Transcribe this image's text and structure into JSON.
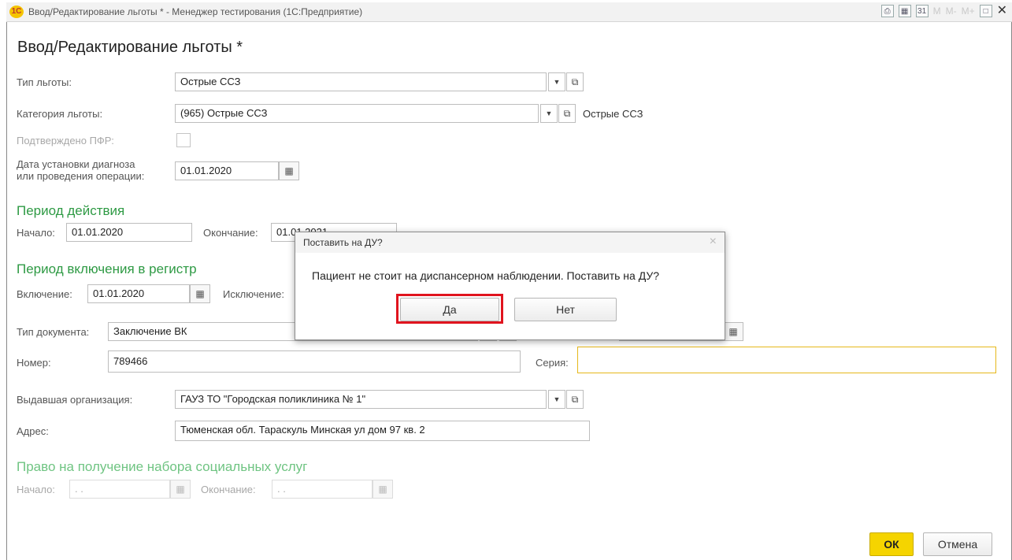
{
  "window": {
    "title": "Ввод/Редактирование льготы * - Менеджер тестирования (1С:Предприятие)",
    "logo_text": "1С"
  },
  "form": {
    "title": "Ввод/Редактирование льготы *",
    "benefit_type": {
      "label": "Тип льготы:",
      "value": "Острые ССЗ"
    },
    "benefit_category": {
      "label": "Категория льготы:",
      "value": "(965) Острые ССЗ",
      "note": "Острые ССЗ"
    },
    "pfr_confirmed": {
      "label": "Подтверждено ПФР:",
      "checked": false
    },
    "diagnosis_date": {
      "label_line1": "Дата установки диагноза",
      "label_line2": "или проведения операции:",
      "value": "01.01.2020"
    },
    "validity_period": {
      "title": "Период действия",
      "start_label": "Начало:",
      "start_value": "01.01.2020",
      "end_label": "Окончание:",
      "end_value": "01.01.2021"
    },
    "register_period": {
      "title": "Период включения в регистр",
      "include_label": "Включение:",
      "include_value": "01.01.2020",
      "exclude_label": "Исключение:"
    },
    "document_type": {
      "label": "Тип документа:",
      "value": "Заключение ВК"
    },
    "number": {
      "label": "Номер:",
      "value": "789466"
    },
    "series": {
      "label": "Серия:",
      "value": ""
    },
    "issuing_org": {
      "label": "Выдавшая организация:",
      "value": "ГАУЗ ТО \"Городская поликлиника № 1\""
    },
    "address": {
      "label": "Адрес:",
      "value": "Тюменская обл. Тараскуль Минская ул дом 97 кв. 2"
    },
    "social_services": {
      "title": "Право на получение набора социальных услуг",
      "start_label": "Начало:",
      "start_value": " .  .",
      "end_label": "Окончание:",
      "end_value": " .  ."
    },
    "ok_label": "ОК",
    "cancel_label": "Отмена"
  },
  "dialog": {
    "title": "Поставить на ДУ?",
    "message": "Пациент не стоит на диспансерном наблюдении. Поставить на ДУ?",
    "yes_label": "Да",
    "no_label": "Нет",
    "close_glyph": "×"
  },
  "colors": {
    "section_green": "#2e9a44",
    "ok_yellow": "#f5d400",
    "highlight_red": "#e0141e"
  }
}
